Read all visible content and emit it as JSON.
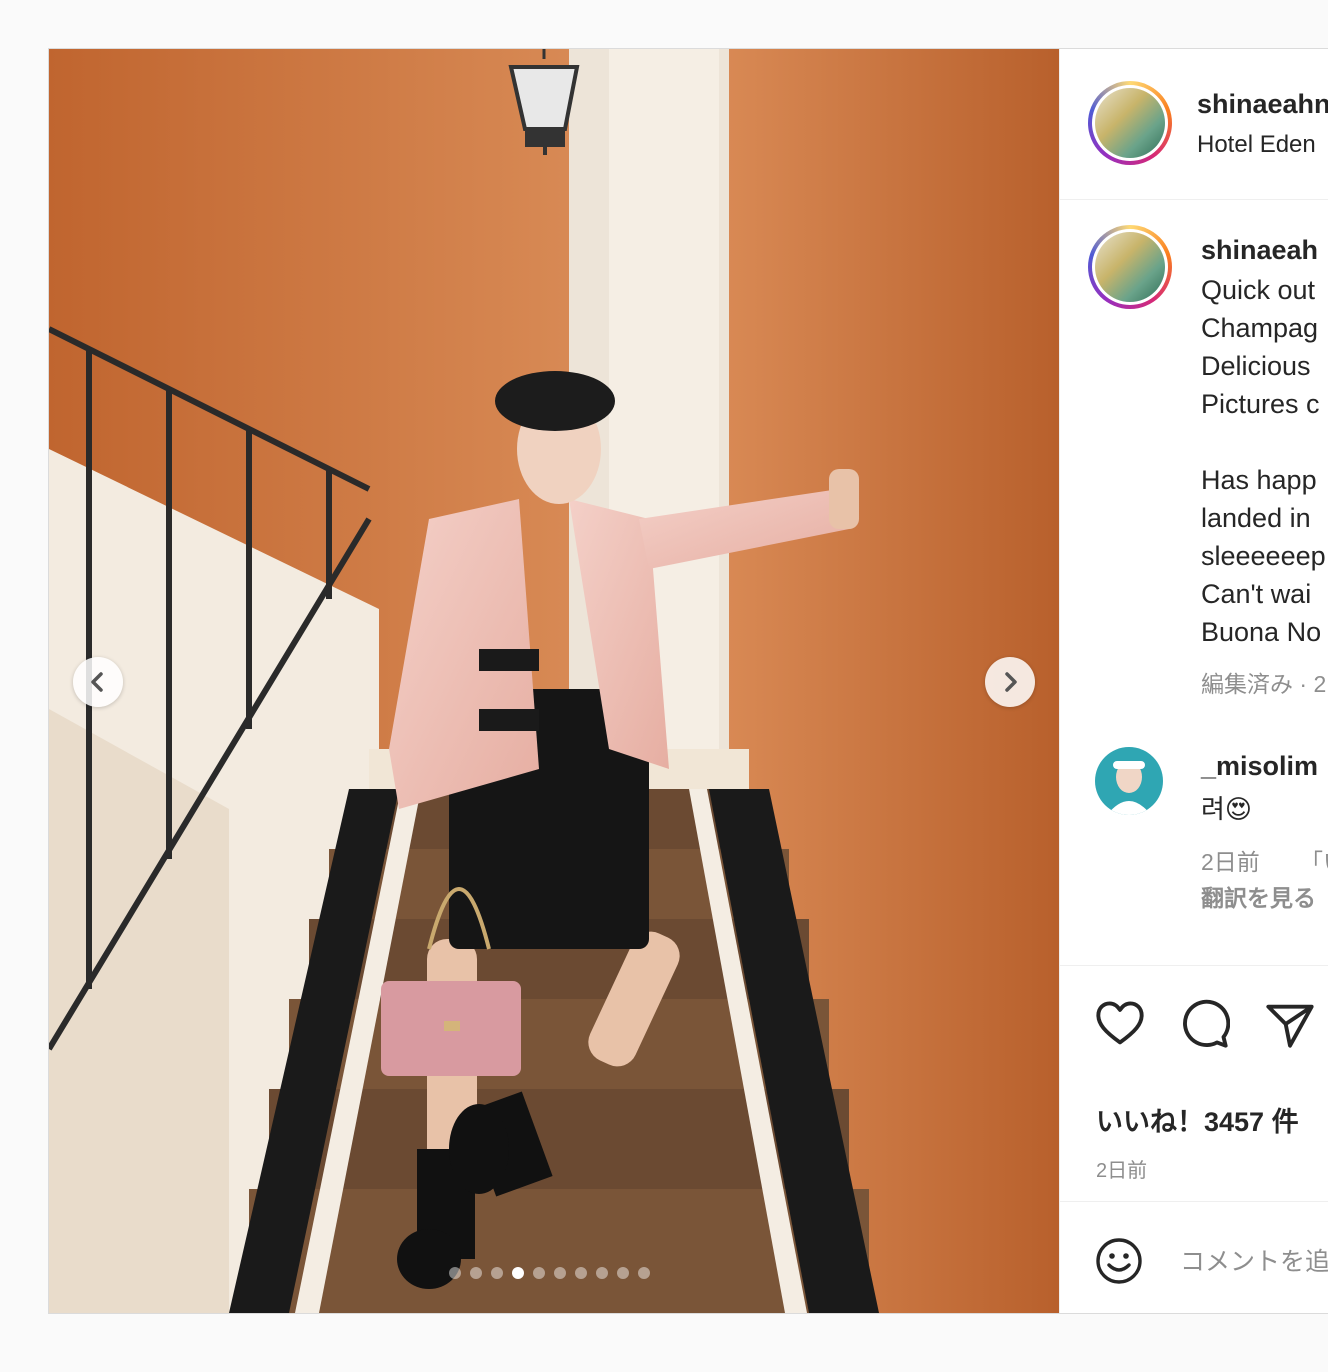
{
  "post": {
    "username": "shinaeahn",
    "location": "Hotel Eden",
    "caption": {
      "username": "shinaeah",
      "lines": [
        "Quick out",
        "Champag",
        "Delicious",
        "Pictures c",
        "",
        "Has happ",
        "landed in",
        "sleeeeeep",
        "Can't wai",
        "Buona No"
      ],
      "meta": "編集済み · 2"
    },
    "comment": {
      "username": "_misolim",
      "text": "려😍",
      "time": "2日前",
      "reply": "「い",
      "translate": "翻訳を見る"
    },
    "likes": "いいね！3457 件",
    "time": "2日前",
    "comment_placeholder": "コメントを追加...",
    "carousel": {
      "total": 10,
      "active_index": 3
    }
  },
  "icons": {
    "prev": "chevron-left-icon",
    "next": "chevron-right-icon",
    "like": "heart-icon",
    "comment": "speech-bubble-icon",
    "share": "paper-plane-icon",
    "emoji": "smiley-icon"
  },
  "colors": {
    "wall": "#c8733f",
    "text": "#262626",
    "secondary_text": "#8e8e8e"
  }
}
